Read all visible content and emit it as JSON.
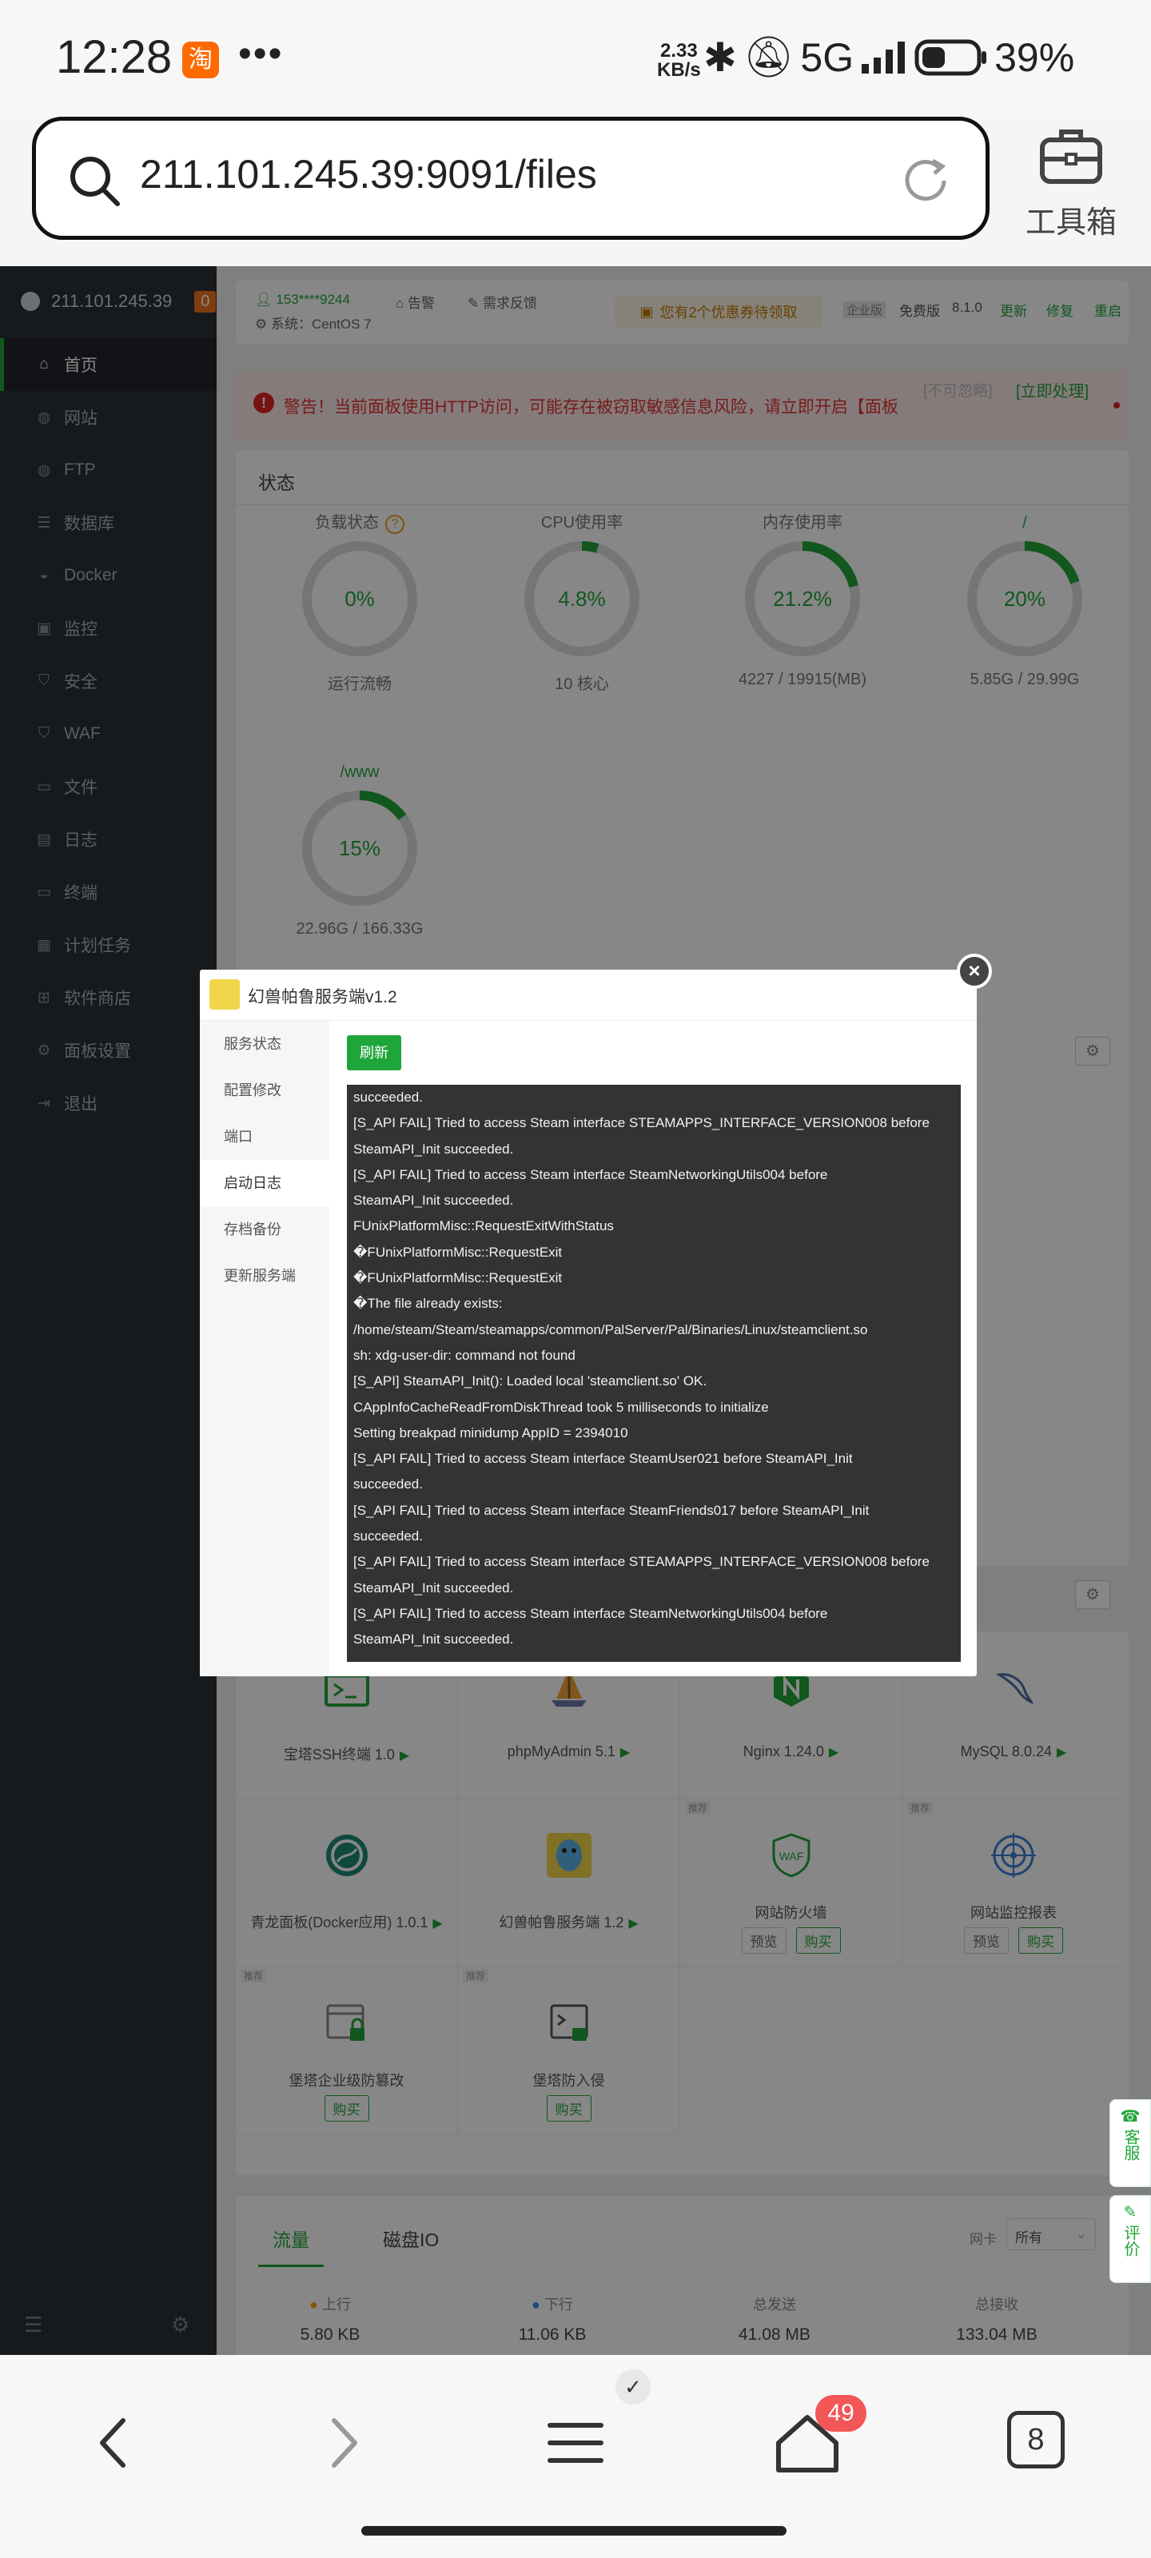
{
  "status_bar": {
    "time": "12:28",
    "taobao": "淘",
    "dots": "•••",
    "rate_top": "2.33",
    "rate_bottom": "KB/s",
    "network": "5G",
    "battery": "39%"
  },
  "browser": {
    "url": "211.101.245.39:9091/files",
    "toolbox_label": "工具箱"
  },
  "sidebar": {
    "host": "211.101.245.39",
    "badge": "0",
    "items": [
      {
        "label": "首页",
        "icon": "home-icon"
      },
      {
        "label": "网站",
        "icon": "globe-icon"
      },
      {
        "label": "FTP",
        "icon": "globe-icon"
      },
      {
        "label": "数据库",
        "icon": "database-icon"
      },
      {
        "label": "Docker",
        "icon": "docker-icon"
      },
      {
        "label": "监控",
        "icon": "monitor-icon"
      },
      {
        "label": "安全",
        "icon": "shield-icon"
      },
      {
        "label": "WAF",
        "icon": "shield-icon"
      },
      {
        "label": "文件",
        "icon": "folder-icon"
      },
      {
        "label": "日志",
        "icon": "log-icon"
      },
      {
        "label": "终端",
        "icon": "terminal-icon"
      },
      {
        "label": "计划任务",
        "icon": "calendar-icon"
      },
      {
        "label": "软件商店",
        "icon": "grid-icon"
      },
      {
        "label": "面板设置",
        "icon": "gear-icon"
      },
      {
        "label": "退出",
        "icon": "logout-icon"
      }
    ]
  },
  "topinfo": {
    "user": "153****9244",
    "alarm": "告警",
    "feedback": "需求反馈",
    "system": "系统：CentOS 7",
    "coupon": "您有2个优惠券待领取",
    "edition_enterprise": "企业版",
    "edition_free": "免费版",
    "version": "8.1.0",
    "update": "更新",
    "repair": "修复",
    "restart": "重启"
  },
  "alert": {
    "text": "警告！当前面板使用HTTP访问，可能存在被窃取敏感信息风险，请立即开启【面板",
    "ignore": "[不可忽略]",
    "action": "[立即处理]"
  },
  "status_card": {
    "title": "状态",
    "gauges": [
      {
        "label": "负载状态",
        "value": "0%",
        "fraction": 0,
        "sub": "运行流畅",
        "has_help": true
      },
      {
        "label": "CPU使用率",
        "value": "4.8%",
        "fraction": 0.048,
        "sub": "10 核心"
      },
      {
        "label": "内存使用率",
        "value": "21.2%",
        "fraction": 0.212,
        "sub": "4227 / 19915(MB)"
      },
      {
        "label": "/",
        "value": "20%",
        "fraction": 0.2,
        "sub": "5.85G / 29.99G"
      },
      {
        "label": "/www",
        "value": "15%",
        "fraction": 0.15,
        "sub": "22.96G / 166.33G"
      }
    ]
  },
  "modal": {
    "title": "幻兽帕鲁服务端v1.2",
    "menu": [
      "服务状态",
      "配置修改",
      "端口",
      "启动日志",
      "存档备份",
      "更新服务端"
    ],
    "active_menu": "启动日志",
    "refresh_label": "刷新",
    "log": [
      "succeeded.",
      "[S_API FAIL] Tried to access Steam interface STEAMAPPS_INTERFACE_VERSION008 before",
      "SteamAPI_Init succeeded.",
      "[S_API FAIL] Tried to access Steam interface SteamNetworkingUtils004 before",
      "SteamAPI_Init succeeded.",
      "FUnixPlatformMisc::RequestExitWithStatus",
      "�FUnixPlatformMisc::RequestExit",
      "�FUnixPlatformMisc::RequestExit",
      "�The file already exists:",
      "/home/steam/Steam/steamapps/common/PalServer/Pal/Binaries/Linux/steamclient.so",
      "sh: xdg-user-dir: command not found",
      "[S_API] SteamAPI_Init(): Loaded local 'steamclient.so' OK.",
      "CAppInfoCacheReadFromDiskThread took 5 milliseconds to initialize",
      "Setting breakpad minidump AppID = 2394010",
      "[S_API FAIL] Tried to access Steam interface SteamUser021 before SteamAPI_Init",
      "succeeded.",
      "[S_API FAIL] Tried to access Steam interface SteamFriends017 before SteamAPI_Init",
      "succeeded.",
      "[S_API FAIL] Tried to access Steam interface STEAMAPPS_INTERFACE_VERSION008 before",
      "SteamAPI_Init succeeded.",
      "[S_API FAIL] Tried to access Steam interface SteamNetworkingUtils004 before",
      "SteamAPI_Init succeeded."
    ]
  },
  "software": {
    "tag_recommend": "推荐",
    "preview_label": "预览",
    "buy_label": "购买",
    "row1": [
      {
        "name": "宝塔SSH终端 1.0"
      },
      {
        "name": "phpMyAdmin 5.1"
      },
      {
        "name": "Nginx 1.24.0"
      },
      {
        "name": "MySQL 8.0.24"
      }
    ],
    "row2": [
      {
        "name": "青龙面板(Docker应用) 1.0.1"
      },
      {
        "name": "幻兽帕鲁服务端 1.2"
      },
      {
        "name": "网站防火墙"
      },
      {
        "name": "网站监控报表"
      }
    ],
    "row3": [
      {
        "name": "堡塔企业级防篡改"
      },
      {
        "name": "堡塔防入侵"
      }
    ]
  },
  "traffic": {
    "tab_flow": "流量",
    "tab_disk": "磁盘IO",
    "nic_label": "网卡",
    "nic_value": "所有",
    "up_label": "上行",
    "up_value": "5.80 KB",
    "down_label": "下行",
    "down_value": "11.06 KB",
    "sent_label": "总发送",
    "sent_value": "41.08 MB",
    "recv_label": "总接收",
    "recv_value": "133.04 MB"
  },
  "side_tabs": {
    "service": "客服",
    "review": "评价"
  },
  "bottom_nav": {
    "tabs_badge": "49",
    "tab_count": "8"
  },
  "colors": {
    "accent": "#20a53a",
    "sidebar": "#2c3138",
    "warning": "#d33"
  }
}
